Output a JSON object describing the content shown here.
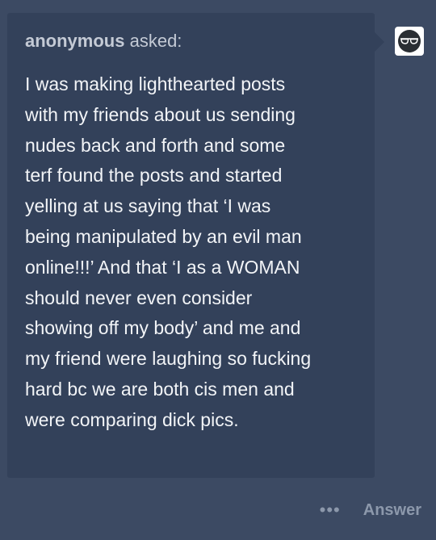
{
  "ask": {
    "asker_name": "anonymous",
    "asked_label": "asked:",
    "question": "I was making lighthearted posts\nwith my friends about us sending\nnudes back and forth and some\nterf found the posts and started\nyelling at us saying that ‘I was\nbeing manipulated by an evil man\nonline!!!’ And that ‘I as a WOMAN\nshould never even consider\nshowing off my body’ and me and\nmy friend were laughing so fucking\nhard bc we are both cis men and\nwere comparing dick pics."
  },
  "avatar": {
    "icon": "sunglasses-face-icon"
  },
  "footer": {
    "more_label": "•••",
    "answer_label": "Answer"
  },
  "colors": {
    "page_background": "#3c4a63",
    "bubble_background": "#33415a",
    "question_text": "#f2f4f7",
    "asker_text": "#c4cad5",
    "footer_text": "#8c98ab"
  }
}
